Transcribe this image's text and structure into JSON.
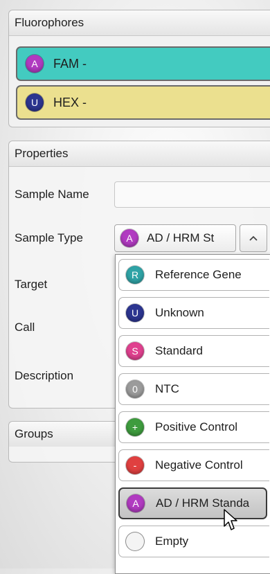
{
  "fluorophores": {
    "title": "Fluorophores",
    "items": [
      {
        "badge": "A",
        "label": "FAM -",
        "bg": "#43cbc0",
        "badge_color": "#b13bc1"
      },
      {
        "badge": "U",
        "label": "HEX -",
        "bg": "#ebe08f",
        "badge_color": "#2c3590"
      }
    ]
  },
  "properties": {
    "title": "Properties",
    "sample_name_label": "Sample Name",
    "sample_name_value": "",
    "sample_type_label": "Sample Type",
    "sample_type": {
      "badge": "A",
      "value": "AD / HRM St",
      "badge_color": "#b13bc1"
    },
    "target_label": "Target",
    "call_label": "Call",
    "description_label": "Description"
  },
  "groups": {
    "title": "Groups"
  },
  "dropdown": {
    "options": [
      {
        "badge": "R",
        "label": "Reference Gene",
        "badge_color": "#2fa3a6"
      },
      {
        "badge": "U",
        "label": "Unknown",
        "badge_color": "#2c3590"
      },
      {
        "badge": "S",
        "label": "Standard",
        "badge_color": "#e0418f"
      },
      {
        "badge": "0",
        "label": "NTC",
        "badge_color": "#9b9b9b"
      },
      {
        "badge": "+",
        "label": "Positive Control",
        "badge_color": "#3e9c3e"
      },
      {
        "badge": "-",
        "label": "Negative Control",
        "badge_color": "#e04040"
      },
      {
        "badge": "A",
        "label": "AD / HRM Standa",
        "badge_color": "#b13bc1",
        "selected": true
      },
      {
        "badge": "",
        "label": "Empty",
        "badge_color": "#f4f4f4"
      }
    ]
  },
  "icons": {
    "combo_toggle": "chevron-up-icon",
    "pointer": "mouse-pointer-icon"
  }
}
